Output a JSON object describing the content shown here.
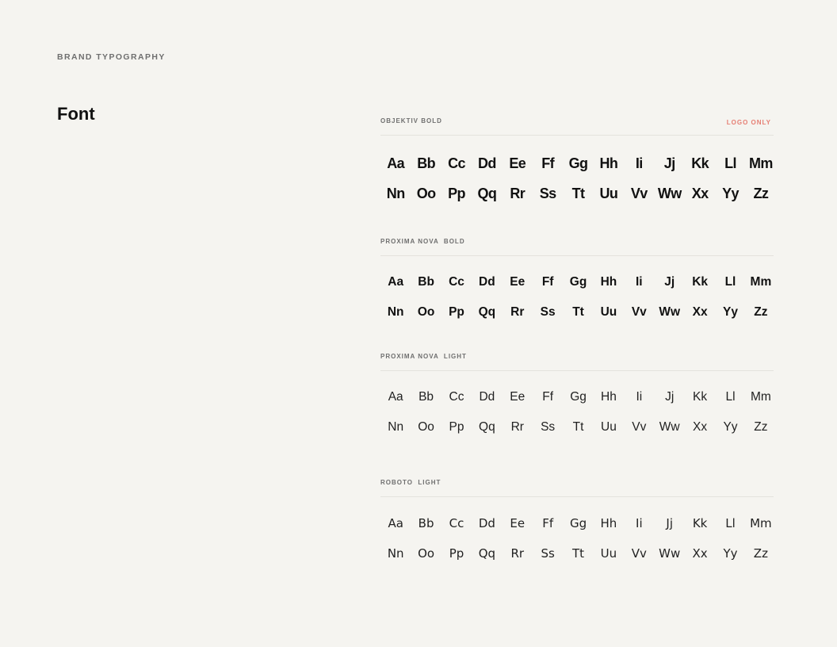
{
  "header": {
    "eyebrow": "BRAND TYPOGRAPHY",
    "title": "Font"
  },
  "fonts": [
    {
      "label": "OBJEKTIV BOLD",
      "note": "LOGO ONLY",
      "rows": [
        [
          "Aa",
          "Bb",
          "Cc",
          "Dd",
          "Ee",
          "Ff",
          "Gg",
          "Hh",
          "Ii",
          "Jj",
          "Kk",
          "Ll",
          "Mm"
        ],
        [
          "Nn",
          "Oo",
          "Pp",
          "Qq",
          "Rr",
          "Ss",
          "Tt",
          "Uu",
          "Vv",
          "Ww",
          "Xx",
          "Yy",
          "Zz"
        ]
      ]
    },
    {
      "label": "PROXIMA NOVA  BOLD",
      "note": "",
      "rows": [
        [
          "Aa",
          "Bb",
          "Cc",
          "Dd",
          "Ee",
          "Ff",
          "Gg",
          "Hh",
          "Ii",
          "Jj",
          "Kk",
          "Ll",
          "Mm"
        ],
        [
          "Nn",
          "Oo",
          "Pp",
          "Qq",
          "Rr",
          "Ss",
          "Tt",
          "Uu",
          "Vv",
          "Ww",
          "Xx",
          "Yy",
          "Zz"
        ]
      ]
    },
    {
      "label": "PROXIMA NOVA  LIGHT",
      "note": "",
      "rows": [
        [
          "Aa",
          "Bb",
          "Cc",
          "Dd",
          "Ee",
          "Ff",
          "Gg",
          "Hh",
          "Ii",
          "Jj",
          "Kk",
          "Ll",
          "Mm"
        ],
        [
          "Nn",
          "Oo",
          "Pp",
          "Qq",
          "Rr",
          "Ss",
          "Tt",
          "Uu",
          "Vv",
          "Ww",
          "Xx",
          "Yy",
          "Zz"
        ]
      ]
    },
    {
      "label": "ROBOTO  LIGHT",
      "note": "",
      "rows": [
        [
          "Aa",
          "Bb",
          "Cc",
          "Dd",
          "Ee",
          "Ff",
          "Gg",
          "Hh",
          "Ii",
          "Jj",
          "Kk",
          "Ll",
          "Mm"
        ],
        [
          "Nn",
          "Oo",
          "Pp",
          "Qq",
          "Rr",
          "Ss",
          "Tt",
          "Uu",
          "Vv",
          "Ww",
          "Xx",
          "Yy",
          "Zz"
        ]
      ]
    }
  ]
}
